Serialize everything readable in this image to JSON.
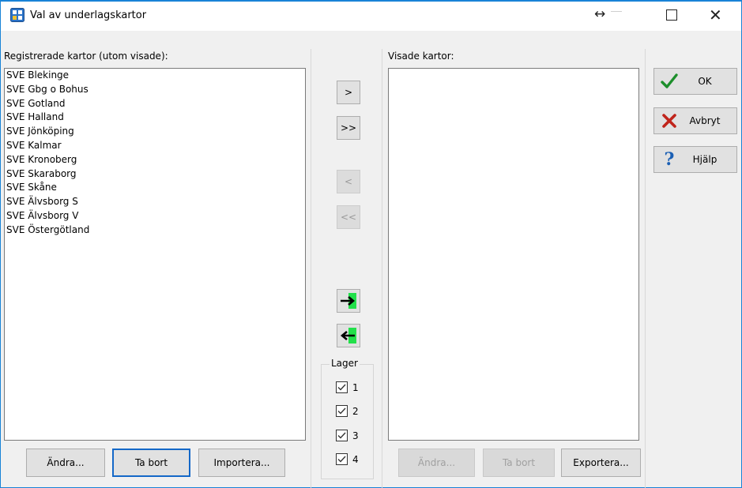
{
  "window": {
    "title": "Val av underlagskartor",
    "title_icon": "window-grid-icon",
    "controls": [
      "resize-icon",
      "minimize-icon",
      "maximize-icon",
      "close-icon"
    ]
  },
  "left_panel": {
    "label": "Registrerade kartor (utom visade):",
    "items": [
      "SVE Blekinge",
      "SVE Gbg o Bohus",
      "SVE Gotland",
      "SVE Halland",
      "SVE Jönköping",
      "SVE Kalmar",
      "SVE Kronoberg",
      "SVE Skaraborg",
      "SVE Skåne",
      "SVE Älvsborg S",
      "SVE Älvsborg V",
      "SVE Östergötland"
    ],
    "buttons": {
      "edit": "Ändra...",
      "remove": "Ta bort",
      "import": "Importera..."
    }
  },
  "middle_panel": {
    "move_right": ">",
    "move_all_right": ">>",
    "move_left": "<",
    "move_all_left": "<<",
    "green_right_icon": "arrow-right-green-icon",
    "green_left_icon": "arrow-left-green-icon",
    "layers": {
      "legend": "Lager",
      "items": [
        {
          "label": "1",
          "checked": true
        },
        {
          "label": "2",
          "checked": true
        },
        {
          "label": "3",
          "checked": true
        },
        {
          "label": "4",
          "checked": true
        }
      ]
    }
  },
  "right_panel": {
    "label": "Visade kartor:",
    "items": [],
    "buttons": {
      "edit": "Ändra...",
      "remove": "Ta bort",
      "export": "Exportera..."
    }
  },
  "side_buttons": {
    "ok": "OK",
    "cancel": "Avbryt",
    "help": "Hjälp",
    "ok_icon": "checkmark-icon",
    "cancel_icon": "x-cross-icon",
    "help_icon": "question-mark-icon"
  },
  "colors": {
    "title_border": "#1883d7",
    "check_green": "#1d8f2c",
    "cross_red": "#c0241b",
    "help_blue": "#1a5fb4",
    "arrow_green": "#22e04a"
  }
}
